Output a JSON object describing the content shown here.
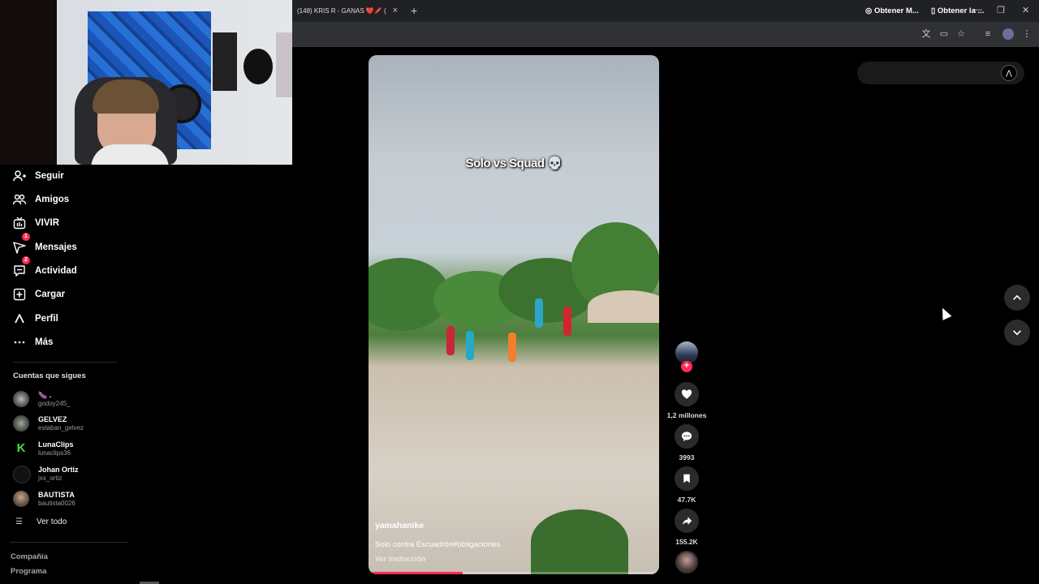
{
  "browser": {
    "tab_title": "(148) KRIS R - GANAS ❤️🖍️ (",
    "tab_close": "×",
    "new_tab": "+",
    "minimize": "—",
    "restore": "❐",
    "close": "✕"
  },
  "sidebar": {
    "items": [
      {
        "label": "Seguir",
        "icon": "person-follow-icon"
      },
      {
        "label": "Amigos",
        "icon": "friends-icon"
      },
      {
        "label": "VIVIR",
        "icon": "live-icon"
      },
      {
        "label": "Mensajes",
        "icon": "messages-icon",
        "badge": "1"
      },
      {
        "label": "Actividad",
        "icon": "activity-icon",
        "badge": "2"
      },
      {
        "label": "Cargar",
        "icon": "upload-icon"
      },
      {
        "label": "Perfil",
        "icon": "profile-icon"
      },
      {
        "label": "Más",
        "icon": "more-icon"
      }
    ],
    "following_title": "Cuentas que sigues",
    "accounts": [
      {
        "name": "🍆 .",
        "handle": "godoy245_"
      },
      {
        "name": "GELVEZ",
        "handle": "estaban_gelvez"
      },
      {
        "name": "LunaClips",
        "handle": "lunaclips36"
      },
      {
        "name": "Johan Ortiz",
        "handle": "jxx_ortiz"
      },
      {
        "name": "BAUTISTA",
        "handle": "bautista0026"
      }
    ],
    "see_all": "Ver todo",
    "footer": [
      "Compañía",
      "Programa"
    ]
  },
  "video": {
    "overlay_text": "Solo vs Squad 💀",
    "author": "yamahanike",
    "caption": "Solo contra Escuadrón#obligaciones",
    "translate": "Ver traducción",
    "progress": 0.32
  },
  "actions": {
    "likes": "1,2 millones",
    "comments": "3993",
    "saves": "47.7K",
    "shares": "155.2K"
  },
  "top_right": {
    "get_app_1": "Obtener M...",
    "get_app_2": "Obtener la ..."
  },
  "colors": {
    "accent": "#fe2c55",
    "background": "#000000"
  }
}
